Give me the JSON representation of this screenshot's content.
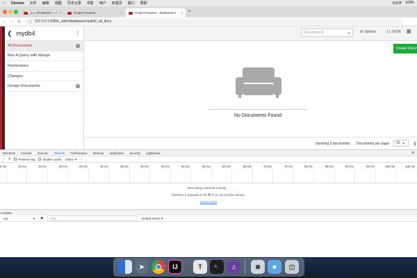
{
  "menubar": {
    "app": "Chrome",
    "items": [
      "文件",
      "编辑",
      "视图",
      "历史记录",
      "书签",
      "用户",
      "标签页",
      "窗口",
      "帮助"
    ],
    "status": [
      "510字",
      "100%"
    ]
  },
  "tabs": [
    {
      "label": "1.1. API Basics — Apache Cou",
      "close": "×"
    },
    {
      "label": "Project Fauxton",
      "close": "×"
    },
    {
      "label": "Project Fauxton - database/m",
      "close": "×"
    }
  ],
  "newtab": "+",
  "address": {
    "url": "127.0.0.1:5984/_utils/#database/mydb4/_all_docs"
  },
  "sidebar": {
    "title": "mydb4",
    "items": [
      {
        "label": "All Documents"
      },
      {
        "label": "Run A Query with Mango"
      },
      {
        "label": "Permissions"
      },
      {
        "label": "Changes"
      },
      {
        "label": "Design Documents"
      }
    ]
  },
  "header": {
    "doc_id_placeholder": "Document ID",
    "options_label": "Options",
    "json_label": "{ } JSON",
    "create_label": "Create Docum"
  },
  "empty": {
    "message": "No Documents Found"
  },
  "footer": {
    "showing": "Showing 0 documents.",
    "per_page_label": "Documents per page:",
    "per_page_value": "20"
  },
  "devtools": {
    "tabs": [
      "Elements",
      "Console",
      "Sources",
      "Network",
      "Performance",
      "Memory",
      "Application",
      "Security",
      "Lighthouse"
    ],
    "active_tab": "Network",
    "preserve_log": "Preserve log",
    "disable_cache": "Disable cache",
    "throttle": "Online",
    "ticks": [
      "5 ms",
      "10 ms",
      "15 ms",
      "20 ms",
      "25 ms",
      "30 ms",
      "35 ms",
      "40 ms",
      "45 ms",
      "50 ms",
      "55 ms",
      "60 ms",
      "65 ms",
      "70 ms",
      "75 ms",
      "80 ms",
      "85 ms",
      "90 ms",
      "95 ms",
      "100 ms",
      "105 ms"
    ],
    "recording": "Recording network activity…",
    "perform": "Perform a request or hit ⌘ R to record the reload.",
    "learn_more": "Learn more",
    "console_title": "Console",
    "console_context": "top",
    "filter_placeholder": "Filter",
    "levels": "Default levels"
  },
  "colors": {
    "accent_red": "#b3222a",
    "create_green": "#20a73f",
    "link_blue": "#1a73e8"
  }
}
